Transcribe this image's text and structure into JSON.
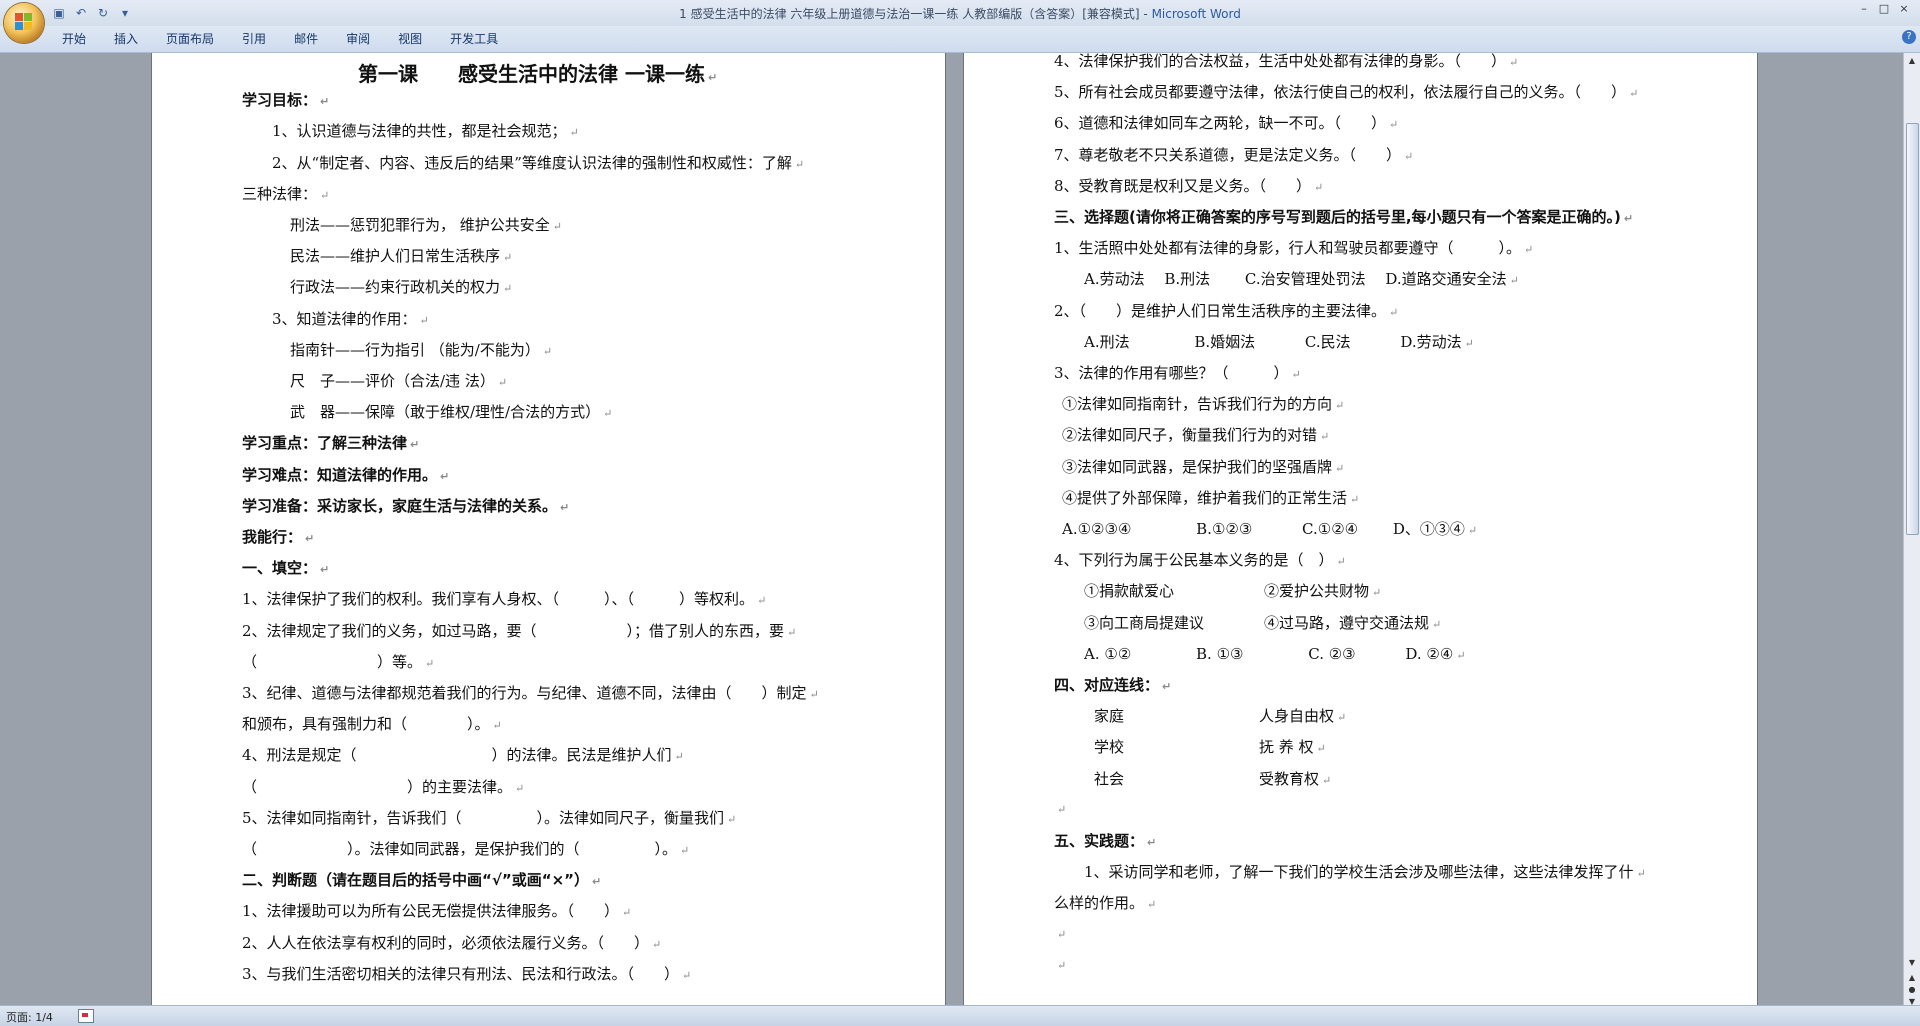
{
  "window": {
    "title": "1 感受生活中的法律 六年级上册道德与法治一课一练 人教部编版（含答案）[兼容模式] - ",
    "app_name": "Microsoft Word",
    "controls": [
      "–",
      "□",
      "×"
    ]
  },
  "quick_access": [
    "save-icon",
    "undo-icon",
    "redo-icon",
    "customize-icon"
  ],
  "ribbon": {
    "tabs": [
      "开始",
      "插入",
      "页面布局",
      "引用",
      "邮件",
      "审阅",
      "视图",
      "开发工具"
    ]
  },
  "page1": {
    "lines": [
      {
        "text": "第一课　　感受生活中的法律  一课一练",
        "style": "title"
      },
      {
        "text": "学习目标：",
        "style": "bold"
      },
      {
        "text": "1、认识道德与法律的共性，都是社会规范；",
        "style": "indent"
      },
      {
        "text": "2、从“制定者、内容、违反后的结果”等维度认识法律的强制性和权威性：了解",
        "style": "indent"
      },
      {
        "text": "三种法律：",
        "style": "normal"
      },
      {
        "text": "刑法——惩罚犯罪行为， 维护公共安全",
        "style": "indent2"
      },
      {
        "text": "民法——维护人们日常生活秩序",
        "style": "indent2"
      },
      {
        "text": "行政法——约束行政机关的权力",
        "style": "indent2"
      },
      {
        "text": "3、知道法律的作用：",
        "style": "indent"
      },
      {
        "text": "指南针——行为指引 （能为/不能为）",
        "style": "indent2"
      },
      {
        "text": "尺　子——评价（合法/违 法）",
        "style": "indent2"
      },
      {
        "text": "武　器——保障（敢于维权/理性/合法的方式）",
        "style": "indent2"
      },
      {
        "text": "学习重点：了解三种法律",
        "style": "bold"
      },
      {
        "text": "学习难点：知道法律的作用。",
        "style": "bold"
      },
      {
        "text": "学习准备：采访家长，家庭生活与法律的关系。",
        "style": "bold"
      },
      {
        "text": "我能行：",
        "style": "bold"
      },
      {
        "text": "一、填空：",
        "style": "bold"
      },
      {
        "text": "1、法律保护了我们的权利。我们享有人身权、（　　　）、（　　　）等权利。",
        "style": "normal"
      },
      {
        "text": "2、法律规定了我们的义务，如过马路，要（　　　　　　）；借了别人的东西，要",
        "style": "normal"
      },
      {
        "text": "（　　　　　　　　）等。",
        "style": "normal"
      },
      {
        "text": "3、纪律、道德与法律都规范着我们的行为。与纪律、道德不同，法律由（　　）制定",
        "style": "normal"
      },
      {
        "text": "和颁布，具有强制力和（　　　　）。",
        "style": "normal"
      },
      {
        "text": "4、刑法是规定（　　　　　　　　　）的法律。民法是维护人们",
        "style": "normal"
      },
      {
        "text": "（　　　　　　　　　　）的主要法律。",
        "style": "normal"
      },
      {
        "text": "5、法律如同指南针，告诉我们（　　　　　）。法律如同尺子，衡量我们",
        "style": "normal"
      },
      {
        "text": "（　　　　　　）。法律如同武器，是保护我们的（　　　　　）。",
        "style": "normal"
      },
      {
        "text": "二、判断题（请在题目后的括号中画“√”或画“×”）",
        "style": "bold"
      },
      {
        "text": "1、法律援助可以为所有公民无偿提供法律服务。（　　）",
        "style": "normal"
      },
      {
        "text": "2、人人在依法享有权利的同时，必须依法履行义务。（　　）",
        "style": "normal"
      },
      {
        "text": "3、与我们生活密切相关的法律只有刑法、民法和行政法。（　　）",
        "style": "normal"
      }
    ]
  },
  "page2": {
    "lines": [
      {
        "text": "4、法律保护我们的合法权益，生活中处处都有法律的身影。（　　）",
        "style": "normal"
      },
      {
        "text": "5、所有社会成员都要遵守法律，依法行使自己的权利，依法履行自己的义务。（　　）",
        "style": "normal"
      },
      {
        "text": "6、道德和法律如同车之两轮，缺一不可。（　　）",
        "style": "normal"
      },
      {
        "text": "7、尊老敬老不只关系道德，更是法定义务。（　　）",
        "style": "normal"
      },
      {
        "text": "8、受教育既是权利又是义务。（　　）",
        "style": "normal"
      },
      {
        "text": "三、选择题(请你将正确答案的序号写到题后的括号里,每小题只有一个答案是正确的。)",
        "style": "bold"
      },
      {
        "text": "1、生活照中处处都有法律的身影，行人和驾驶员都要遵守（　　　）。",
        "style": "normal"
      },
      {
        "text": "A.劳动法　 B.刑法　　 C.治安管理处罚法　 D.道路交通安全法",
        "style": "indent"
      },
      {
        "text": "2、（　　）是维护人们日常生活秩序的主要法律。",
        "style": "normal"
      },
      {
        "text": "A.刑法　　　　 B.婚姻法　　　 C.民法　　　 D.劳动法",
        "style": "indent"
      },
      {
        "text": "3、法律的作用有哪些？（　　　）",
        "style": "normal"
      },
      {
        "text": "①法律如同指南针，告诉我们行为的方向",
        "style": "half"
      },
      {
        "text": "②法律如同尺子，衡量我们行为的对错",
        "style": "half"
      },
      {
        "text": "③法律如同武器，是保护我们的坚强盾牌",
        "style": "half"
      },
      {
        "text": "④提供了外部保障，维护着我们的正常生活",
        "style": "half"
      },
      {
        "text": "A.①②③④　　　　 B.①②③　　　 C.①②④　　 D、①③④",
        "style": "half"
      },
      {
        "text": "4、下列行为属于公民基本义务的是（　）",
        "style": "normal"
      },
      {
        "text": "①捐款献爱心　　　　　　②爱护公共财物",
        "style": "indent"
      },
      {
        "text": "③向工商局提建议　　　　④过马路，遵守交通法规",
        "style": "indent"
      },
      {
        "text": "A. ①②　　　　 B. ①③　　　　 C. ②③　　　 D. ②④",
        "style": "indent"
      },
      {
        "text": "四、对应连线：",
        "style": "bold"
      },
      {
        "text": "家庭　　　　　　　　　人身自由权",
        "style": "indent3"
      },
      {
        "text": "学校　　　　　　　　　抚 养 权",
        "style": "indent3"
      },
      {
        "text": "社会　　　　　　　　　受教育权",
        "style": "indent3"
      },
      {
        "text": "",
        "style": "normal"
      },
      {
        "text": "五、实践题：",
        "style": "bold"
      },
      {
        "text": "1、采访同学和老师，了解一下我们的学校生活会涉及哪些法律，这些法律发挥了什",
        "style": "indent"
      },
      {
        "text": "么样的作用。",
        "style": "normal"
      },
      {
        "text": "",
        "style": "normal"
      },
      {
        "text": "",
        "style": "normal"
      }
    ]
  },
  "status": {
    "page": "页面: 1/4"
  }
}
